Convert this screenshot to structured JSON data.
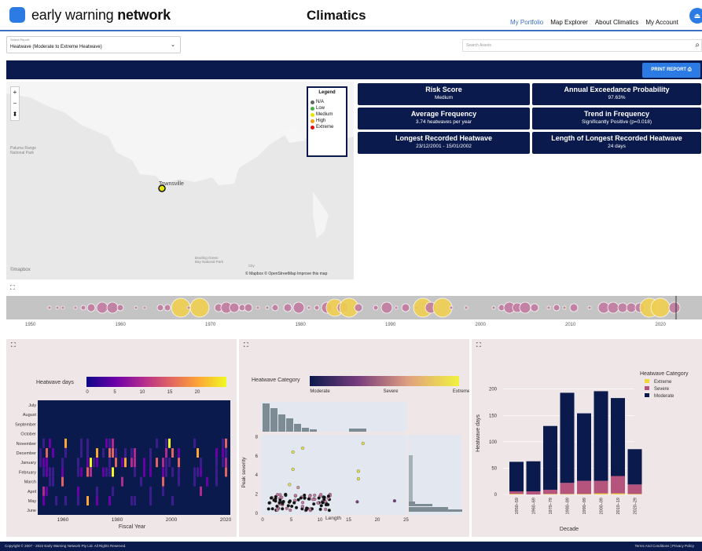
{
  "header": {
    "brand_regular": "early warning ",
    "brand_bold": "network",
    "app_title": "Climatics",
    "nav": [
      "My Portfolio",
      "Map Explorer",
      "About Climatics",
      "My Account"
    ],
    "logout_icon": "logout-icon"
  },
  "report_select": {
    "label": "Select Report",
    "value": "Heatwave (Moderate to Extreme Heatwave)"
  },
  "search": {
    "placeholder": "Search Assets"
  },
  "toolbar": {
    "print_label": "PRINT REPORT"
  },
  "map": {
    "place": "Townsville",
    "park": "Paluma Range\nNational Park",
    "park2": "Bowling Green\nBay National Park",
    "city": "City",
    "attribution": "© Mapbox © OpenStreetMap  Improve this map",
    "mapbox": "©mapbox",
    "legend": {
      "title": "Legend",
      "items": [
        {
          "label": "N/A",
          "color": "#666666"
        },
        {
          "label": "Low",
          "color": "#4cae4c"
        },
        {
          "label": "Medium",
          "color": "#e6e600"
        },
        {
          "label": "High",
          "color": "#f0a30a"
        },
        {
          "label": "Extreme",
          "color": "#e01010"
        }
      ]
    }
  },
  "cards": [
    {
      "title": "Risk Score",
      "value": "Medium"
    },
    {
      "title": "Annual Exceedance Probability",
      "value": "97.63%"
    },
    {
      "title": "Average Frequency",
      "value": "3.74 heatwaves per year"
    },
    {
      "title": "Trend in Frequency",
      "value": "Significantly Positive (p=0.018)"
    },
    {
      "title": "Longest Recorded Heatwave",
      "value": "23/12/2001 - 15/01/2002"
    },
    {
      "title": "Length of Longest Recorded Heatwave",
      "value": "24 days"
    }
  ],
  "timeline": {
    "ticks": [
      "1950",
      "1960",
      "1970",
      "1980",
      "1990",
      "2000",
      "2010",
      "2020"
    ]
  },
  "heatmap": {
    "colorbar_title": "Heatwave days",
    "colorbar_ticks": [
      "0",
      "5",
      "10",
      "15",
      "20"
    ],
    "months": [
      "July",
      "August",
      "September",
      "October",
      "November",
      "December",
      "January",
      "February",
      "March",
      "April",
      "May",
      "June"
    ],
    "x_ticks": [
      "1960",
      "1980",
      "2000",
      "2020"
    ],
    "xlabel": "Fiscal Year"
  },
  "scatter": {
    "colorbar_title": "Heatwave Category",
    "colorbar_ticks": [
      "Moderate",
      "Severe",
      "Extreme"
    ],
    "ylabel": "Peak severity",
    "xlabel": "Length",
    "x_ticks": [
      "0",
      "5",
      "10",
      "15",
      "20",
      "25"
    ],
    "y_ticks": [
      "0",
      "2",
      "4",
      "6",
      "8"
    ]
  },
  "chart_data": [
    {
      "type": "bar",
      "stacked": true,
      "title": "",
      "xlabel": "Decade",
      "ylabel": "Heatwave days",
      "categories": [
        "1950–59",
        "1960–69",
        "1970–79",
        "1980–89",
        "1990–99",
        "2000–09",
        "2010–19",
        "2020–29"
      ],
      "ylim": [
        0,
        210
      ],
      "y_ticks": [
        "0",
        "50",
        "100",
        "150",
        "200"
      ],
      "legend": {
        "title": "Heatwave Category",
        "position": "top-right"
      },
      "series": [
        {
          "name": "Extreme",
          "color": "#f0d83a",
          "values": [
            1,
            0,
            1,
            1,
            1,
            2,
            2,
            1
          ]
        },
        {
          "name": "Severe",
          "color": "#b5557e",
          "values": [
            5,
            6,
            8,
            21,
            25,
            24,
            33,
            18
          ]
        },
        {
          "name": "Moderate",
          "color": "#0b1a4d",
          "values": [
            56,
            57,
            121,
            171,
            128,
            170,
            148,
            67
          ]
        }
      ]
    }
  ],
  "footer": {
    "copyright": "Copyright © 2007 - 2022 Early Warning Network Pty Ltd. All Rights Reserved.",
    "links": "Terms And Conditions | Privacy Policy"
  }
}
